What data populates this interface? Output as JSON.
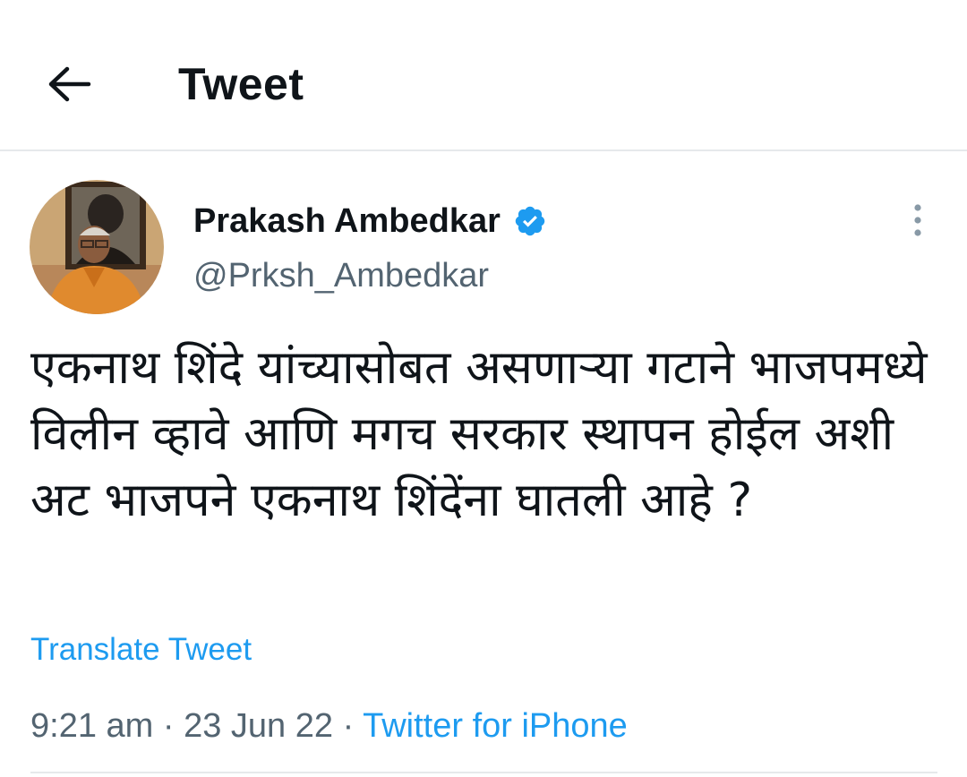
{
  "header": {
    "title": "Tweet",
    "back_icon": "arrow-left-icon"
  },
  "author": {
    "name": "Prakash Ambedkar",
    "handle": "@Prksh_Ambedkar",
    "verified_icon": "verified-badge-icon",
    "verified_color": "#1d9bf0"
  },
  "tweet": {
    "text": "एकनाथ शिंदे यांच्यासोबत असणाऱ्या गटाने भाजपमध्ये विलीन व्हावे आणि मगच सरकार स्थापन होईल अशी अट भाजपने एकनाथ शिंदेंना घातली आहे ?",
    "translate_label": "Translate Tweet",
    "time": "9:21 am",
    "separator": "·",
    "date": "23 Jun 22",
    "source": "Twitter for iPhone"
  },
  "colors": {
    "text_primary": "#0f1419",
    "text_secondary": "#536471",
    "link": "#1d9bf0",
    "divider": "#e6e9eb"
  },
  "icons": {
    "more": "more-vertical-icon"
  }
}
